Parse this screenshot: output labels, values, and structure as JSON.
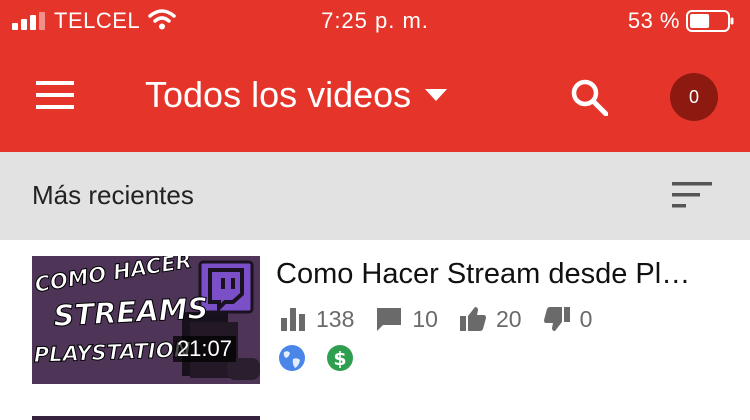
{
  "status_bar": {
    "carrier": "TELCEL",
    "time": "7:25 p. m.",
    "battery_percent": "53 %",
    "battery_level": 0.53,
    "icons": [
      "signal-icon",
      "wifi-icon",
      "battery-icon"
    ]
  },
  "app_bar": {
    "title": "Todos los videos",
    "notification_count": "0",
    "icons": [
      "menu-icon",
      "dropdown-icon",
      "search-icon"
    ]
  },
  "section": {
    "label": "Más recientes",
    "icons": [
      "sort-icon"
    ]
  },
  "videos": [
    {
      "title": "Como Hacer Stream desde Pl…",
      "duration": "21:07",
      "views": "138",
      "comments": "10",
      "likes": "20",
      "dislikes": "0",
      "thumbnail_text": [
        "COMO HACER",
        "STREAMS",
        "PLAYSTATION"
      ],
      "icons": [
        "views-icon",
        "comments-icon",
        "like-icon",
        "dislike-icon",
        "public-globe-icon",
        "monetized-dollar-icon",
        "twitch-logo-icon"
      ]
    }
  ],
  "colors": {
    "header": "#e5352a",
    "badge": "#8c1a11",
    "section_bar": "#e2e2e2",
    "globe": "#4a86e8",
    "dollar": "#2f9e4f",
    "twitch": "#7b4fc8"
  }
}
